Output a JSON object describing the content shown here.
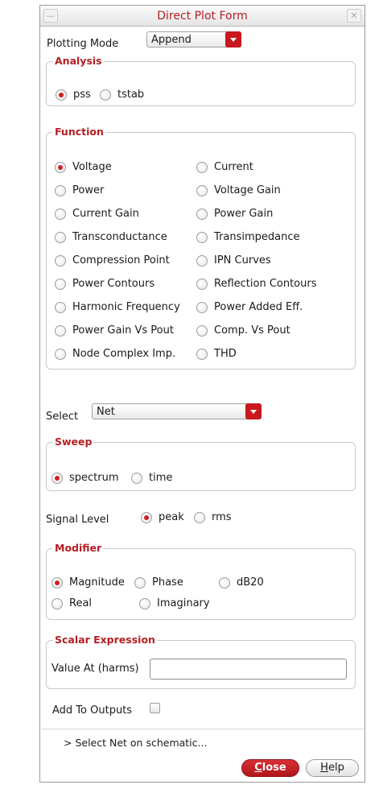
{
  "window": {
    "title": "Direct Plot Form"
  },
  "plotting_mode": {
    "label": "Plotting Mode",
    "value": "Append"
  },
  "analysis": {
    "title": "Analysis",
    "options": [
      {
        "label": "pss",
        "selected": true
      },
      {
        "label": "tstab",
        "selected": false
      }
    ]
  },
  "function": {
    "title": "Function",
    "options": [
      {
        "label": "Voltage",
        "selected": true
      },
      {
        "label": "Current",
        "selected": false
      },
      {
        "label": "Power",
        "selected": false
      },
      {
        "label": "Voltage Gain",
        "selected": false
      },
      {
        "label": "Current Gain",
        "selected": false
      },
      {
        "label": "Power Gain",
        "selected": false
      },
      {
        "label": "Transconductance",
        "selected": false
      },
      {
        "label": "Transimpedance",
        "selected": false
      },
      {
        "label": "Compression Point",
        "selected": false
      },
      {
        "label": "IPN Curves",
        "selected": false
      },
      {
        "label": "Power Contours",
        "selected": false
      },
      {
        "label": "Reflection Contours",
        "selected": false
      },
      {
        "label": "Harmonic Frequency",
        "selected": false
      },
      {
        "label": "Power Added Eff.",
        "selected": false
      },
      {
        "label": "Power Gain Vs Pout",
        "selected": false
      },
      {
        "label": "Comp. Vs Pout",
        "selected": false
      },
      {
        "label": "Node Complex Imp.",
        "selected": false
      },
      {
        "label": "THD",
        "selected": false
      }
    ]
  },
  "select": {
    "label": "Select",
    "value": "Net"
  },
  "sweep": {
    "title": "Sweep",
    "options": [
      {
        "label": "spectrum",
        "selected": true
      },
      {
        "label": "time",
        "selected": false
      }
    ]
  },
  "signal_level": {
    "label": "Signal Level",
    "options": [
      {
        "label": "peak",
        "selected": true
      },
      {
        "label": "rms",
        "selected": false
      }
    ]
  },
  "modifier": {
    "title": "Modifier",
    "options": [
      {
        "label": "Magnitude",
        "selected": true
      },
      {
        "label": "Phase",
        "selected": false
      },
      {
        "label": "dB20",
        "selected": false
      },
      {
        "label": "Real",
        "selected": false
      },
      {
        "label": "Imaginary",
        "selected": false
      }
    ]
  },
  "scalar_expression": {
    "title": "Scalar Expression",
    "value_at_label": "Value At (harms)",
    "value_at": ""
  },
  "add_to_outputs": {
    "label": "Add To Outputs",
    "checked": false
  },
  "status": "> Select Net on schematic...",
  "buttons": {
    "close": {
      "mnemonic": "C",
      "rest": "lose"
    },
    "help": {
      "mnemonic": "H",
      "rest": "elp"
    }
  },
  "colors": {
    "accent": "#b51e23",
    "radio_dot": "#d21f25"
  }
}
